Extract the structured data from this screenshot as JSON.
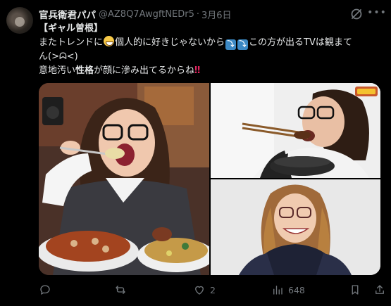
{
  "post": {
    "display_name": "官兵衛君パパ",
    "handle": "@AZ8Q7AwgftNEDr5",
    "separator": "·",
    "date": "3月6日",
    "text": {
      "line1": "【ギャル曽根】",
      "line2_a": "またトレンドに",
      "line2_b": "個人的に好きじゃないから",
      "line2_c": "この方が出るTVは観まて",
      "line3": "ん(>ᗣ<)",
      "line4_a": "意地汚い",
      "line4_b": "性格",
      "line4_c": "が顔に滲み出てるからね",
      "bang": "‼"
    },
    "emoji": {
      "grin": "grinning-face-with-sweat",
      "key1": "⤵",
      "key2": "⤵"
    }
  },
  "actions": {
    "reply_count": "",
    "repost_count": "",
    "like_count": "2",
    "views_count": "648"
  }
}
